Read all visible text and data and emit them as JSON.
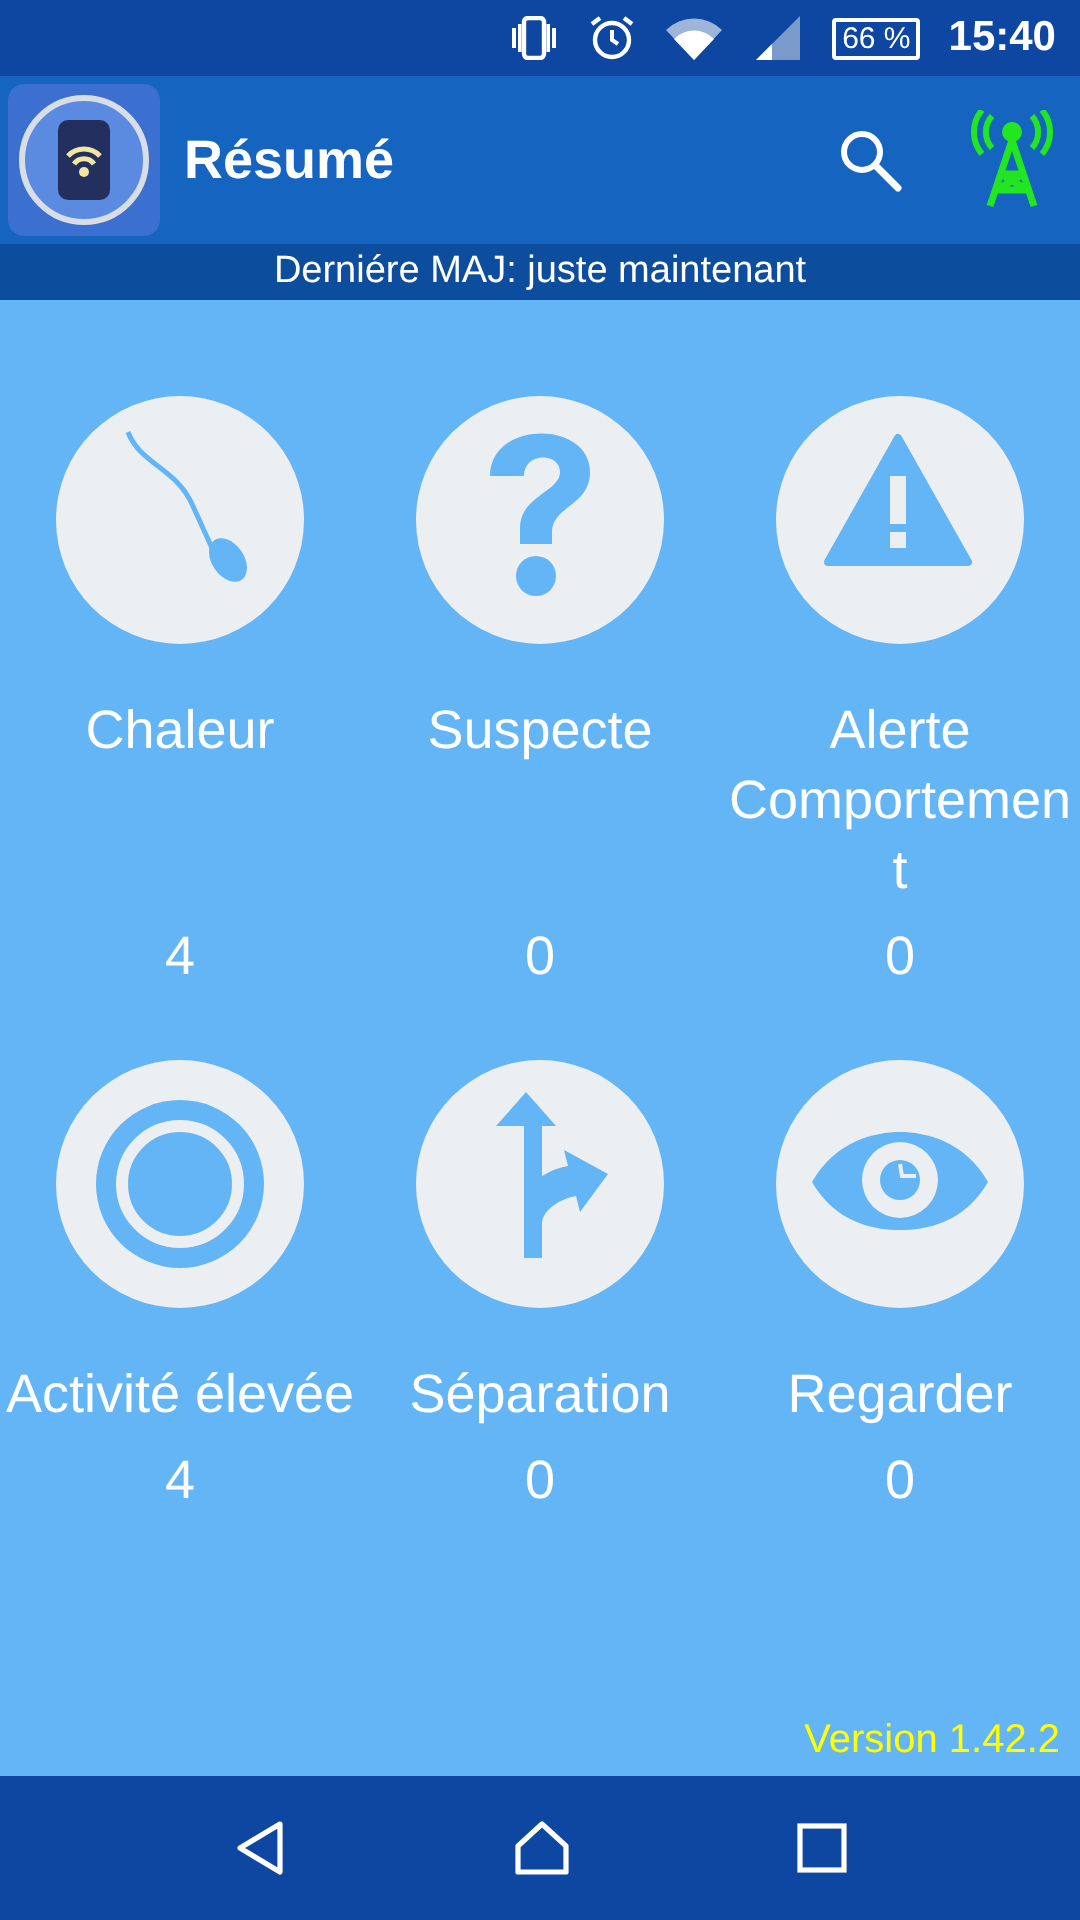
{
  "status_bar": {
    "battery": "66 %",
    "time": "15:40"
  },
  "app_bar": {
    "title": "Résumé"
  },
  "update_line": "Derniére MAJ: juste maintenant",
  "tiles": [
    {
      "kind": "sperm",
      "label": "Chaleur",
      "count": "4"
    },
    {
      "kind": "question",
      "label": "Suspecte",
      "count": "0"
    },
    {
      "kind": "warning",
      "label": "Alerte Comportement",
      "count": "0"
    },
    {
      "kind": "target",
      "label": "Activité élevée",
      "count": "4"
    },
    {
      "kind": "fork",
      "label": "Séparation",
      "count": "0"
    },
    {
      "kind": "eye",
      "label": "Regarder",
      "count": "0"
    }
  ],
  "version": "Version 1.42.2"
}
